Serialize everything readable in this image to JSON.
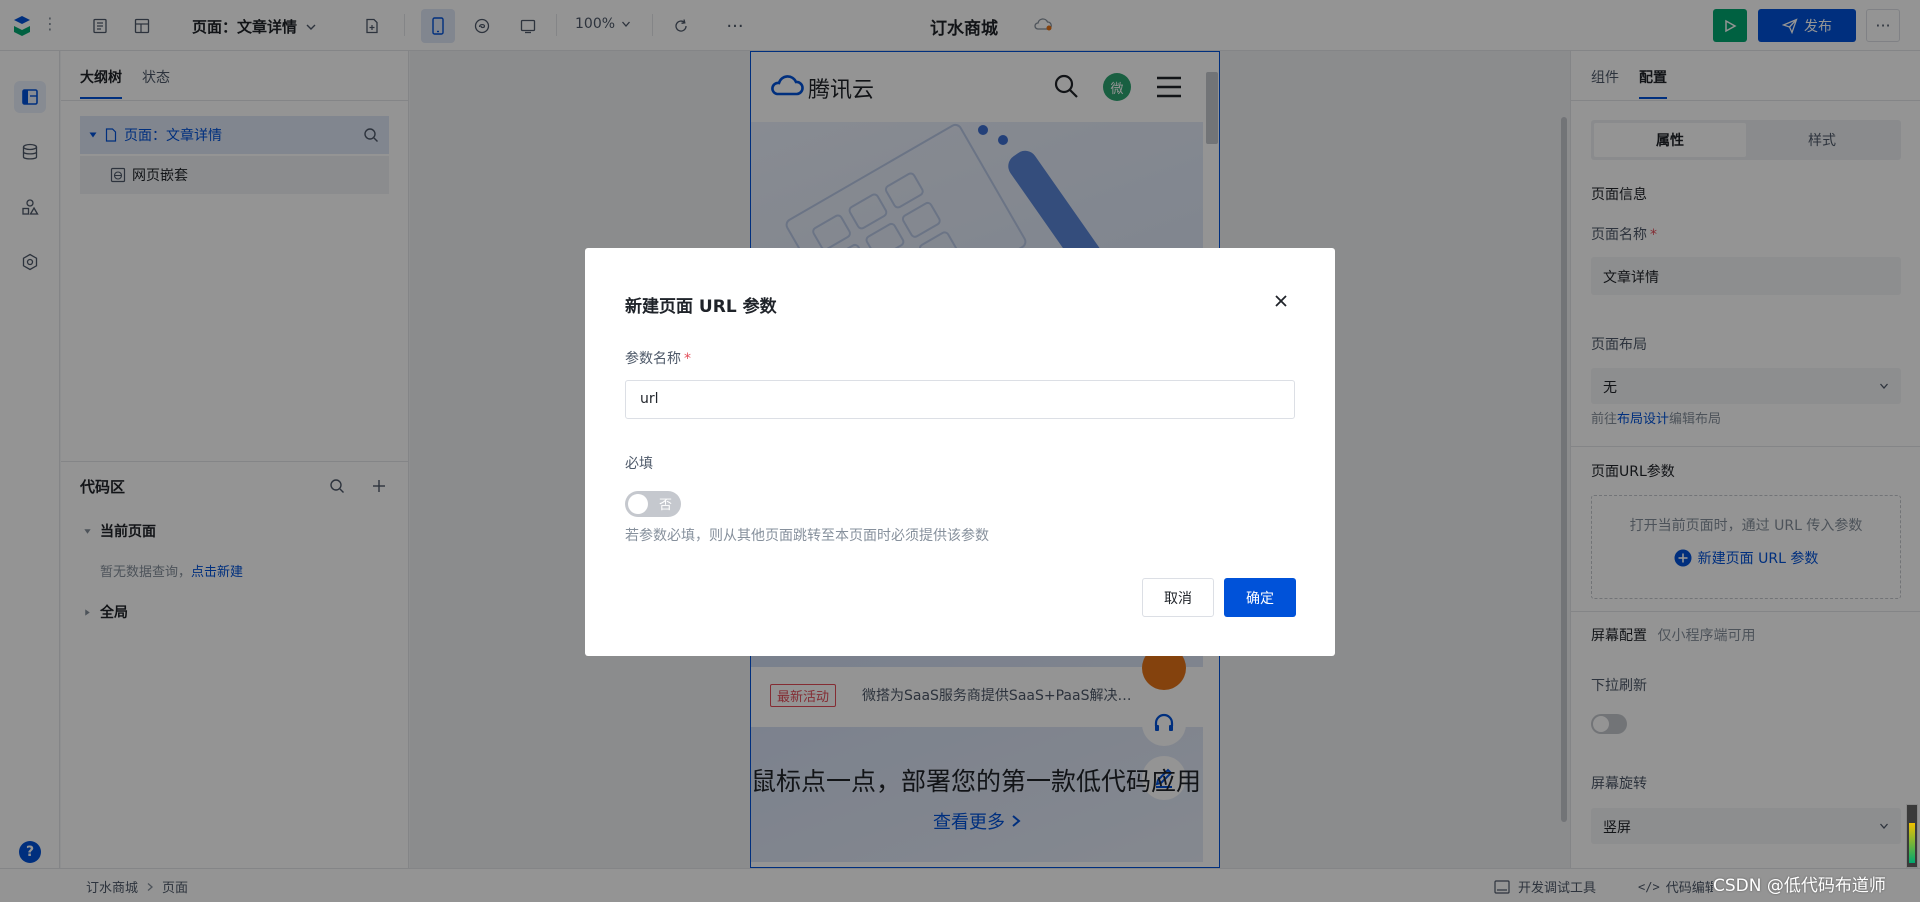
{
  "topbar": {
    "page_selector": "页面：文章详情",
    "zoom": "100%",
    "app_title": "订水商城",
    "publish": "发布"
  },
  "left_panel": {
    "tabs": [
      "大纲树",
      "状态"
    ],
    "tree_root": "页面：文章详情",
    "tree_child": "网页嵌套",
    "code_area": {
      "title": "代码区",
      "current_page": "当前页面",
      "empty_text": "暂无数据查询，",
      "create_link": "点击新建",
      "global": "全局"
    }
  },
  "phone": {
    "brand": "腾讯云",
    "avatar_char": "微",
    "badge": "最新活动",
    "news": "微搭为SaaS服务商提供SaaS+PaaS解决…",
    "headline": "鼠标点一点，部署您的第一款低代码应用",
    "more": "查看更多"
  },
  "right_panel": {
    "tabs": [
      "组件",
      "配置"
    ],
    "seg": [
      "属性",
      "样式"
    ],
    "page_info": "页面信息",
    "page_name_label": "页面名称",
    "page_name_value": "文章详情",
    "layout_label": "页面布局",
    "layout_value": "无",
    "layout_hint_pre": "前往",
    "layout_hint_link": "布局设计",
    "layout_hint_post": "编辑布局",
    "url_param_label": "页面URL参数",
    "url_param_hint": "打开当前页面时，通过 URL 传入参数",
    "url_param_add": "新建页面 URL 参数",
    "screen_config": "屏幕配置",
    "screen_config_hint": "仅小程序端可用",
    "pull_refresh": "下拉刷新",
    "rotation_label": "屏幕旋转",
    "rotation_value": "竖屏"
  },
  "bottombar": {
    "crumb1": "订水商城",
    "crumb2": "页面",
    "dev_tools": "开发调试工具",
    "code_editor": "代码编辑器",
    "watermark": "CSDN @低代码布道师"
  },
  "modal": {
    "title": "新建页面 URL 参数",
    "param_label": "参数名称",
    "param_value": "url",
    "required_label": "必填",
    "toggle_text": "否",
    "hint": "若参数必填，则从其他页面跳转至本页面时必须提供该参数",
    "cancel": "取消",
    "confirm": "确定"
  },
  "colors": {
    "primary": "#0052d9",
    "run_button": "#00a870",
    "danger": "#e34d59"
  }
}
